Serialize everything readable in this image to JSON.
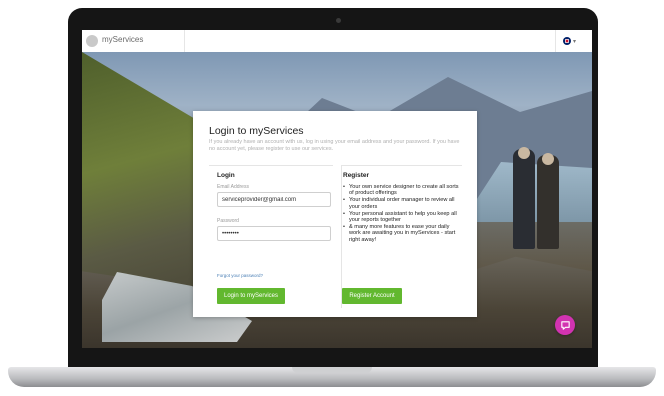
{
  "app": {
    "brand_name": "myServices"
  },
  "login_card": {
    "title": "Login to myServices",
    "intro": "If you already have an account with us, log in using your email address and your password. If you have no account yet, please register to use our services.",
    "login": {
      "heading": "Login",
      "email_label": "Email Address",
      "email_value": "serviceprovider@gmail.com",
      "password_label": "Password",
      "password_value": "••••••••",
      "forgot_link": "Forgot your password?",
      "submit_label": "Login to myServices"
    },
    "register": {
      "heading": "Register",
      "features": [
        "Your own service designer to create all sorts of product offerings",
        "Your individual order manager to review all your orders",
        "Your personal assistant to help you keep all your reports together",
        "& many more features to ease your daily work are awaiting you in myServices - start right away!"
      ],
      "submit_label": "Register Account"
    }
  },
  "icons": {
    "language": "uk-flag-icon",
    "chat": "chat-bubble-icon"
  },
  "colors": {
    "primary_button": "#62b82f",
    "chat_button": "#d233b1",
    "link": "#4a7fb5"
  }
}
